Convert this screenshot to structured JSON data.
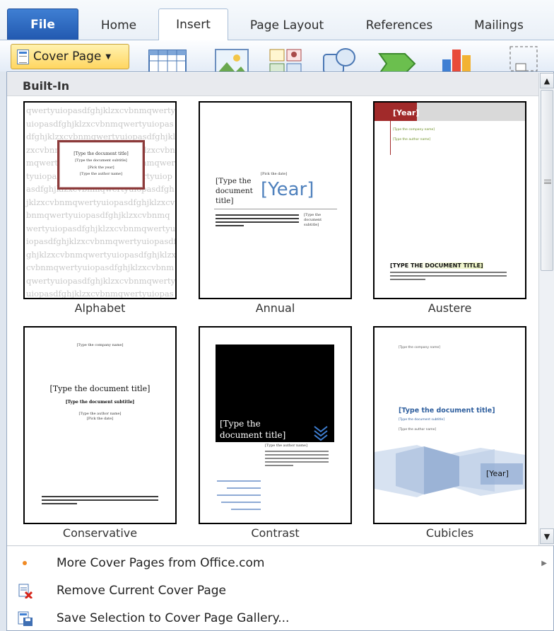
{
  "ribbon": {
    "tabs": [
      "File",
      "Home",
      "Insert",
      "Page Layout",
      "References",
      "Mailings"
    ],
    "active_tab": "Insert",
    "cover_page_button": "Cover Page",
    "icons": [
      "table-icon",
      "picture-icon",
      "clip-art-icon",
      "shapes-icon",
      "smartart-icon",
      "chart-icon",
      "screenshot-icon"
    ]
  },
  "gallery": {
    "section_header": "Built-In",
    "items": [
      {
        "name": "Alphabet"
      },
      {
        "name": "Annual"
      },
      {
        "name": "Austere"
      },
      {
        "name": "Conservative"
      },
      {
        "name": "Contrast"
      },
      {
        "name": "Cubicles"
      }
    ],
    "alphabet": {
      "filler": "qwertyuiopasdfghjklzxcvbnmqwertyuiopasdfghjklzxcvbnmqwertyuiopasdfghjklzxcvbnmqwertyuiopasdfghjklzxcvbnmqwertyuiopasdfghjklzxcvbnmqwertyuiopasdfghjklzxcvbnmqwertyuiopasdfghjklzxcvbnmqwertyuiopasdfghjklzxcvbnmqwertyuiopasdfghjklzxcvbnmqwertyuiopasdfghjklzxcvbnmqwertyuiopasdfghjklzxcvbnmqwertyuiopasdfghjklzxcvbnmqwertyuiopasdfghjklzxcvbnmqwertyuiopasdfghjklzxcvbnmqwertyuiopasdfghjklzxcvbnmqwertyuiopasdfghjklzxcvbnmqwertyuiopasdfghjklzxcvbnmqwertyuiopasdfghjklzxcvbnmqwertyuiopasdfghjklzxcvbnmqwertyuiopasdfghjklzxcvbnm",
      "title": "[Type the document title]",
      "subtitle": "[Type the document subtitle]",
      "year": "[Pick the year]",
      "author": "[Type the author name]"
    },
    "annual": {
      "date": "[Pick the date]",
      "title": "[Type the document title]",
      "year": "[Year]",
      "subtitle": "[Type the document subtitle]"
    },
    "austere": {
      "year": "[Year]",
      "company": "[Type the company name]",
      "author": "[Type the author name]",
      "title": "[TYPE THE DOCUMENT TITLE]"
    },
    "conservative": {
      "company": "[Type the company name]",
      "title": "[Type the document title]",
      "subtitle": "[Type the document subtitle]",
      "author": "[Type the author name]",
      "date": "[Pick the date]"
    },
    "contrast": {
      "title": "[Type the document title]",
      "author": "[Type the author name]"
    },
    "cubicles": {
      "company": "[Type the company name]",
      "title": "[Type the document title]",
      "subtitle": "[Type the document subtitle]",
      "author": "[Type the author name]",
      "year": "[Year]"
    }
  },
  "menu": {
    "more": "More Cover Pages from Office.com",
    "remove": "Remove Current Cover Page",
    "save": "Save Selection to Cover Page Gallery..."
  },
  "colors": {
    "file_tab": "#2b63be",
    "cover_button": "#ffd965",
    "austere_red": "#a12a2a",
    "annual_blue": "#4f81bd",
    "contrast_black": "#000000",
    "cubicles_blue": "#9bb3d6"
  }
}
